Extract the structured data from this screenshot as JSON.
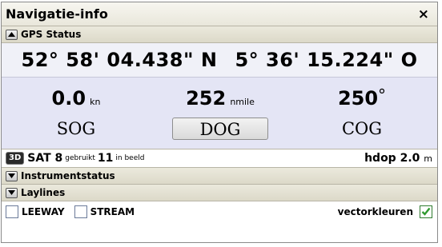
{
  "window": {
    "title": "Navigatie-info",
    "close_symbol": "×"
  },
  "gps_section": {
    "title": "GPS Status",
    "state": "expanded"
  },
  "position": {
    "latitude": "52° 58' 04.438\" N",
    "longitude": "5° 36' 15.224\" O"
  },
  "readouts": [
    {
      "value": "0.0",
      "unit": "kn",
      "label": "SOG"
    },
    {
      "value": "252",
      "unit": "nmile",
      "label": "DOG"
    },
    {
      "value": "250",
      "unit": "°",
      "label": "COG"
    }
  ],
  "satellites": {
    "fix_badge": "3D",
    "prefix": "SAT",
    "used": "8",
    "used_label": "gebruikt",
    "in_view": "11",
    "in_view_label": "in beeld",
    "hdop_label": "hdop",
    "hdop_value": "2.0",
    "hdop_unit": "m"
  },
  "sections": [
    {
      "title": "Instrumentstatus",
      "state": "collapsed"
    },
    {
      "title": "Laylines",
      "state": "collapsed"
    }
  ],
  "options": {
    "leeway": {
      "label": "LEEWAY",
      "checked": false
    },
    "stream": {
      "label": "STREAM",
      "checked": false
    },
    "vector_colors": {
      "label": "vectorkleuren",
      "checked": true
    }
  },
  "colors": {
    "coords_background": "#f0f1f8",
    "data_background": "#e4e5f5",
    "check_mark": "#2f9a2f"
  }
}
